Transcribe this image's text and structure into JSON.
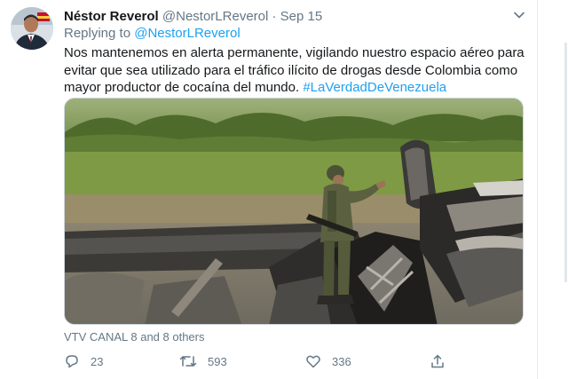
{
  "tweet": {
    "author_name": "Néstor Reverol",
    "author_handle": "@NestorLReverol",
    "separator": "·",
    "date": "Sep 15",
    "replying_prefix": "Replying to ",
    "replying_handle": "@NestorLReverol",
    "text": "Nos mantenemos en alerta permanente, vigilando nuestro espacio aéreo para evitar que sea utilizado para el tráfico ilícito de drogas desde Colombia como mayor productor de cocaína del mundo. ",
    "hashtag": "#LaVerdadDeVenezuela",
    "tagged": "VTV CANAL 8 and 8 others",
    "replies": "23",
    "retweets": "593",
    "likes": "336"
  },
  "icons": {
    "more": "chevron-down-icon",
    "reply": "reply-icon",
    "retweet": "retweet-icon",
    "like": "heart-icon",
    "share": "share-icon"
  },
  "colors": {
    "link": "#1da1f2",
    "secondary": "#657786",
    "primary": "#14171a"
  }
}
